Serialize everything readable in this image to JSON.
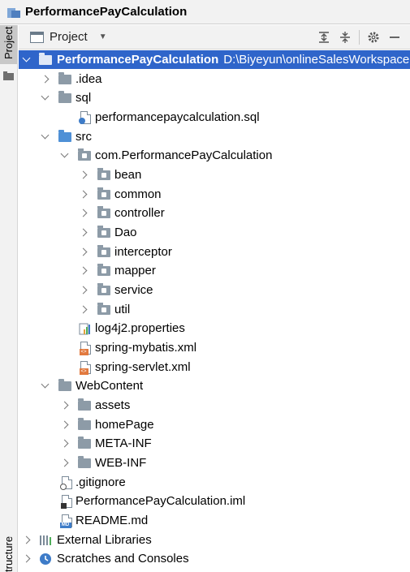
{
  "window": {
    "title": "PerformancePayCalculation"
  },
  "side": {
    "project_tab": "Project",
    "structure_tab": "tructure"
  },
  "toolbar": {
    "view_label": "Project"
  },
  "tree": {
    "root_label": "PerformancePayCalculation",
    "root_path": "D:\\Biyeyun\\onlineSalesWorkspace",
    "idea": ".idea",
    "sql": "sql",
    "sql_file": "performancepaycalculation.sql",
    "src": "src",
    "package": "com.PerformancePayCalculation",
    "pkg_bean": "bean",
    "pkg_common": "common",
    "pkg_controller": "controller",
    "pkg_dao": "Dao",
    "pkg_interceptor": "interceptor",
    "pkg_mapper": "mapper",
    "pkg_service": "service",
    "pkg_util": "util",
    "log4j2": "log4j2.properties",
    "spring_mybatis": "spring-mybatis.xml",
    "spring_servlet": "spring-servlet.xml",
    "webcontent": "WebContent",
    "assets": "assets",
    "homepage": "homePage",
    "meta_inf": "META-INF",
    "web_inf": "WEB-INF",
    "gitignore": ".gitignore",
    "iml": "PerformancePayCalculation.iml",
    "readme": "README.md",
    "md_badge": "MD",
    "external_libraries": "External Libraries",
    "scratches": "Scratches and Consoles"
  },
  "colors": {
    "selection": "#2f65ca",
    "folder": "#8d9ba7",
    "source_folder": "#4f90d6"
  }
}
